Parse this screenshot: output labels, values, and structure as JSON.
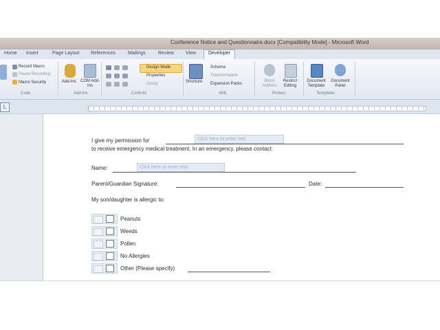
{
  "window": {
    "title": "Conference Notice and Questionnaire.docx [Compatibility Mode] - Microsoft Word"
  },
  "tabs": [
    "Home",
    "Insert",
    "Page Layout",
    "References",
    "Mailings",
    "Review",
    "View",
    "Developer"
  ],
  "active_tab": "Developer",
  "ribbon": {
    "code": {
      "record_macro": "Record Macro",
      "pause_recording": "Pause Recording",
      "macro_security": "Macro Security",
      "group": "Code"
    },
    "addins": {
      "addins": "Add-Ins",
      "com_addins": "COM Add-Ins",
      "group": "Add-Ins"
    },
    "controls": {
      "design_mode": "Design Mode",
      "properties": "Properties",
      "group_btn": "Group",
      "group": "Controls"
    },
    "xml": {
      "structure": "Structure",
      "schema": "Schema",
      "transformation": "Transformation",
      "expansion_packs": "Expansion Packs",
      "group": "XML"
    },
    "protect": {
      "block_authors": "Block Authors",
      "restrict_editing": "Restrict Editing",
      "group": "Protect"
    },
    "templates": {
      "document_template": "Document Template",
      "document_panel": "Document Panel",
      "group": "Templates"
    }
  },
  "document": {
    "line1": "I give my permission for",
    "placeholder": "Click here to enter text.",
    "line2": "to receive emergency medical treatment. In an emergency, please contact:",
    "name_label": "Name:",
    "signature_label": "Parent/Guardian Signature:",
    "date_label": "Date:",
    "allergy_label": "My son/daughter is allergic to:",
    "options": [
      "Peanuts",
      "Weeds",
      "Pollen",
      "No Allergies",
      "Other (Please specify)"
    ]
  }
}
